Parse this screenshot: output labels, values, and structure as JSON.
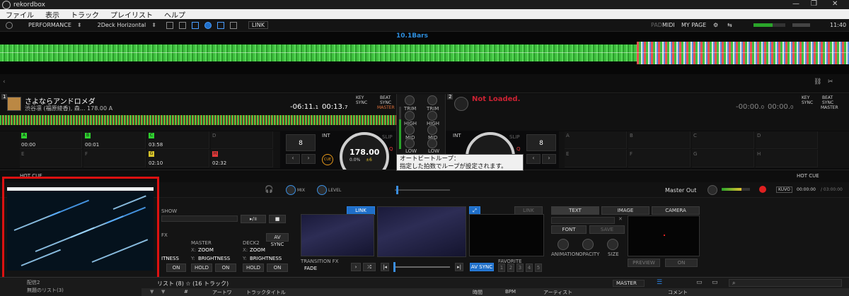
{
  "titlebar": {
    "app_title": "rekordbox",
    "min_icon": "minimize-icon",
    "max_icon": "maximize-icon",
    "close_icon": "close-icon"
  },
  "menu": [
    "ファイル",
    "表示",
    "トラック",
    "プレイリスト",
    "ヘルプ"
  ],
  "toolbar": {
    "mode": "PERFORMANCE",
    "layout": "2Deck Horizontal",
    "link": "LINK",
    "pad": "PAD",
    "midi": "MIDI",
    "my_page": "MY PAGE",
    "time": "11:40"
  },
  "overview": {
    "bars_label": "10.1Bars",
    "waveform_color": "#3fbf3f"
  },
  "deck1": {
    "number": "1",
    "title": "さよならアンドロメダ",
    "artist_bpm": "渋谷凛 (福原綾香), 森...  178.00  A",
    "remain": "-06:11.",
    "remain_frac": "1",
    "elapsed": "00:13.",
    "elapsed_frac": "7",
    "key_sync": "KEY\nSYNC",
    "beat_sync": "BEAT\nSYNC",
    "master": "MASTER",
    "bpm": "178.00",
    "pitch": "0.0%",
    "pitch_range": "±6",
    "int": "INT",
    "slip": "SLIP",
    "q": "Q",
    "mt": "MT",
    "cue": "CUE",
    "loop_beats": "8"
  },
  "deck2": {
    "number": "2",
    "status": "Not Loaded.",
    "remain": "-00:00.",
    "remain_frac": "0",
    "elapsed": "00:00.",
    "elapsed_frac": "0",
    "key_sync": "KEY\nSYNC",
    "beat_sync": "BEAT\nSYNC",
    "master": "MASTER",
    "int": "INT",
    "slip": "SLIP",
    "q": "Q",
    "mt": "MT",
    "loop_beats": "8"
  },
  "mixer": {
    "trim": "TRIM",
    "high": "HIGH",
    "mid": "MID",
    "low": "LOW"
  },
  "hot_cues_1": [
    {
      "letter": "A",
      "time": "00:00",
      "color": "#2fd12f"
    },
    {
      "letter": "B",
      "time": "00:01",
      "color": "#2fd12f"
    },
    {
      "letter": "C",
      "time": "03:58",
      "color": "#2fd12f"
    },
    {
      "letter": "D",
      "time": "",
      "color": ""
    },
    {
      "letter": "E",
      "time": "",
      "color": ""
    },
    {
      "letter": "F",
      "time": "",
      "color": ""
    },
    {
      "letter": "G",
      "time": "02:10",
      "color": "#d8c42a"
    },
    {
      "letter": "H",
      "time": "02:32",
      "color": "#e03a3a"
    }
  ],
  "hot_cues_2": [
    {
      "letter": "A"
    },
    {
      "letter": "B"
    },
    {
      "letter": "C"
    },
    {
      "letter": "D"
    },
    {
      "letter": "E"
    },
    {
      "letter": "F"
    },
    {
      "letter": "G"
    },
    {
      "letter": "H"
    }
  ],
  "hot_cue_label": "HOT CUE",
  "tooltip": {
    "line1": "オートビートループ：",
    "line2": "指定した拍数でループが設定されます。"
  },
  "mixrow": {
    "mix": "MIX",
    "level": "LEVEL",
    "master_out": "Master Out",
    "kuvo": "KUVO",
    "time_pos": "00:00:00",
    "time_total": "/ 03:00:00"
  },
  "video": {
    "show": "SHOW",
    "av_sync": "AV SYNC",
    "fx": "FX",
    "master": "MASTER",
    "deck2": "DECK2",
    "x_label": "X:",
    "y_label": "Y:",
    "zoom": "ZOOM",
    "brightness": "BRIGHTNESS",
    "brightness_partial": "ITNESS",
    "hold": "HOLD",
    "on": "ON",
    "link": "LINK",
    "transition_fx": "TRANSITION FX",
    "fade": "FADE",
    "av_sync2": "AV SYNC",
    "favorite": "FAVORITE",
    "fav_nums": [
      "1",
      "2",
      "3",
      "4",
      "5"
    ],
    "text_tab": "TEXT",
    "image_tab": "IMAGE",
    "camera_tab": "CAMERA",
    "font": "FONT",
    "save": "SAVE",
    "animation": "ANIMATION",
    "opacity": "OPACITY",
    "size": "SIZE",
    "preview": "PREVIEW",
    "on2": "ON"
  },
  "browser": {
    "master_select": "MASTER",
    "playlist_label": "リスト (8) ☆ (16 トラック)",
    "tree_items": [
      "配信2",
      "無題のリスト(3)"
    ],
    "columns": [
      "#",
      "アートワ",
      "トラックタイトル",
      "時間",
      "BPM",
      "アーティスト",
      "コメント"
    ]
  }
}
